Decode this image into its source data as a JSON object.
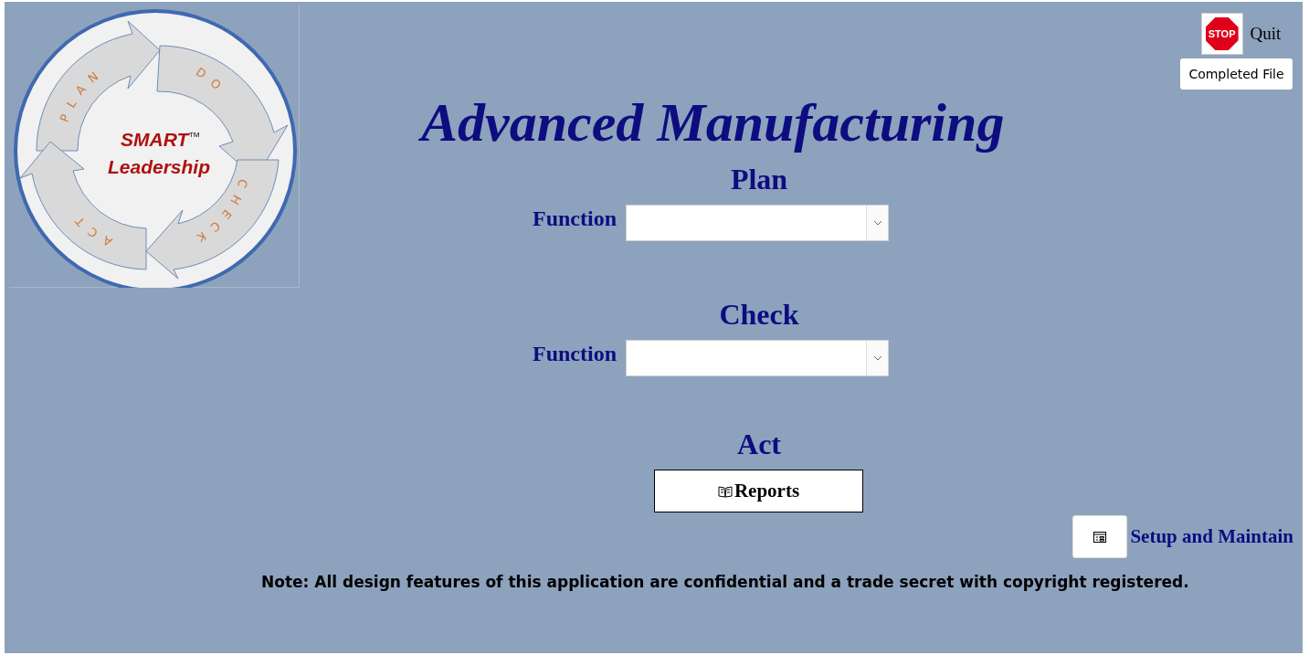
{
  "logo": {
    "stages": [
      {
        "text": "PLAN",
        "kind": "northwest"
      },
      {
        "text": "DO",
        "kind": "northeast"
      },
      {
        "text": "ACT",
        "kind": "southwest"
      },
      {
        "text": "CHECK",
        "kind": "southeast"
      }
    ],
    "brand": "SMART",
    "trademark": "™",
    "tagline": "Leadership"
  },
  "title": "Advanced Manufacturing",
  "quit": {
    "icon_text": "STOP",
    "label": "Quit"
  },
  "completed_button": "Completed File",
  "sections": [
    {
      "kind": "select",
      "heading": "Plan",
      "label": "Function"
    },
    {
      "kind": "select",
      "heading": "Check",
      "label": "Function"
    },
    {
      "kind": "button",
      "heading": "Act",
      "button": "Reports"
    }
  ],
  "setup": {
    "label": "Setup and Maintain"
  },
  "note": "Note: All design features of this application are confidential and a trade secret with copyright registered."
}
